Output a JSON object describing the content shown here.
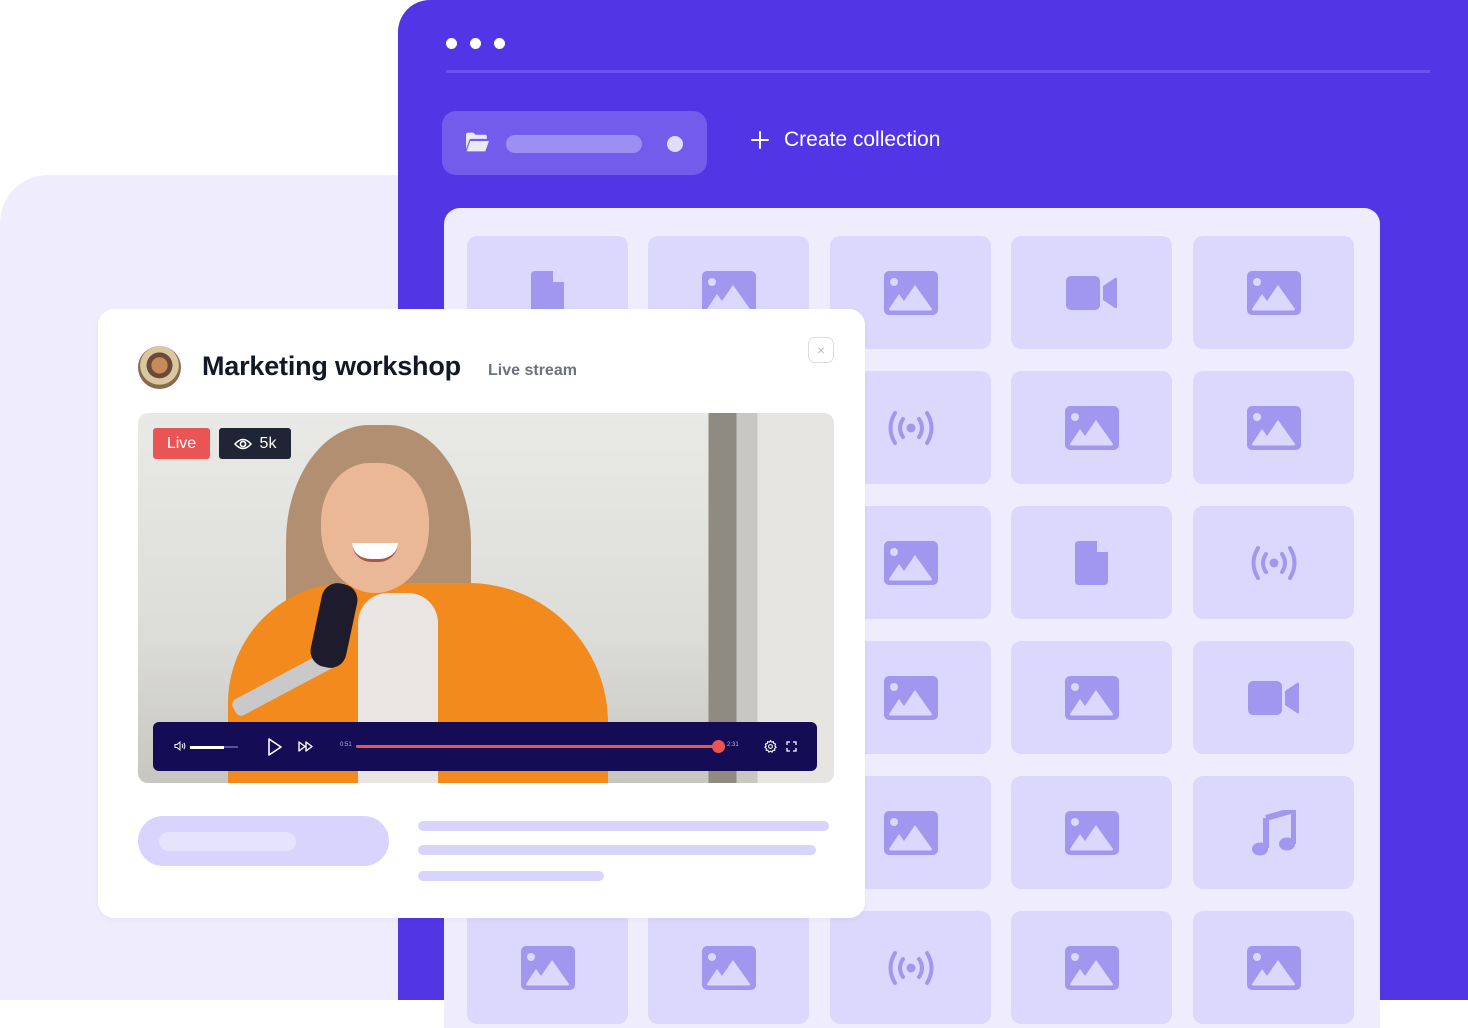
{
  "window": {
    "collection_chip": {
      "has_label_placeholder": true
    },
    "create_collection_label": "Create collection"
  },
  "grid": {
    "tiles": [
      [
        "file",
        "image",
        "image",
        "video",
        "image"
      ],
      [
        "hidden",
        "hidden",
        "live",
        "image",
        "image"
      ],
      [
        "hidden",
        "hidden",
        "image",
        "file",
        "live"
      ],
      [
        "hidden",
        "hidden",
        "image",
        "image",
        "video"
      ],
      [
        "hidden",
        "hidden",
        "image",
        "image",
        "music"
      ],
      [
        "image",
        "image",
        "live",
        "image",
        "image"
      ]
    ]
  },
  "modal": {
    "title": "Marketing workshop",
    "subtitle": "Live stream",
    "close_label": "×",
    "video": {
      "live_badge": "Live",
      "viewers": "5k",
      "current_time": "0:51",
      "total_time": "2:31",
      "progress_fraction": 0.99,
      "volume_fraction": 0.7
    }
  },
  "colors": {
    "brand": "#5236e5",
    "panel": "#efedfd",
    "tile": "#dcd8fd",
    "tile_icon": "#a197ee",
    "live_red": "#ea5455",
    "player_bg": "#140c55"
  }
}
